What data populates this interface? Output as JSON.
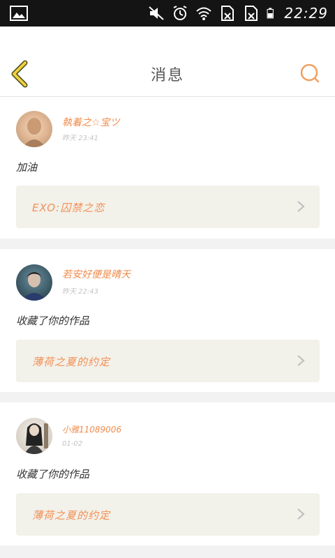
{
  "status_bar": {
    "time": "22:29",
    "icons": [
      "image-icon",
      "mute-icon",
      "alarm-icon",
      "wifi-icon",
      "no-sim-icon",
      "no-sim-icon",
      "battery-icon"
    ]
  },
  "header": {
    "title": "消息",
    "back_icon": "chevron-left-icon",
    "search_icon": "search-icon",
    "accent_color": "#f0b24d"
  },
  "messages": [
    {
      "username": "執着之☆宝ツ",
      "time": "昨天 23:41",
      "content": "加油",
      "reference": "EXO:囚禁之恋"
    },
    {
      "username": "若安好便是晴天",
      "time": "昨天 22:43",
      "content": "收藏了你的作品",
      "reference": "薄荷之夏的约定"
    },
    {
      "username": "小雅11089006",
      "time": "01-02",
      "content": "收藏了你的作品",
      "reference": "薄荷之夏的约定"
    }
  ],
  "colors": {
    "username": "#f08c4d",
    "reference_text": "#f29055",
    "reference_bg": "#f2f1ea",
    "page_bg": "#f2f2f2"
  }
}
